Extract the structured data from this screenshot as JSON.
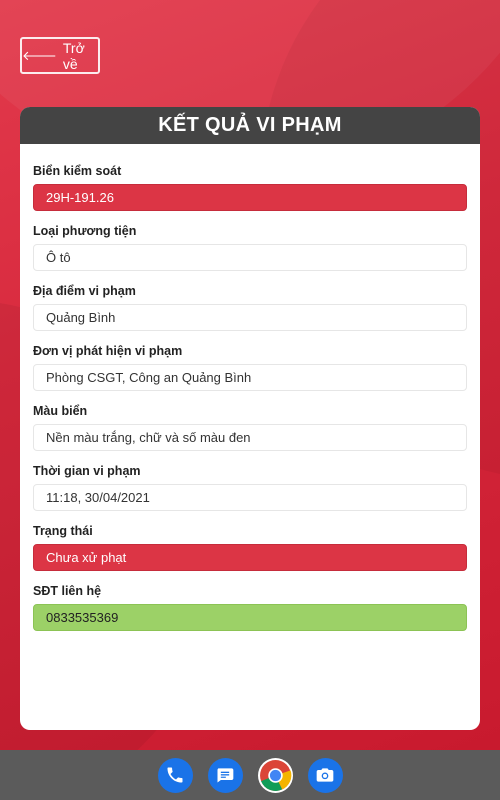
{
  "back_button": {
    "label": "Trở về",
    "icon": "arrow-left-icon"
  },
  "card": {
    "title": "KẾT QUẢ VI PHẠM",
    "fields": [
      {
        "label": "Biển kiểm soát",
        "value": "29H-191.26",
        "style": "red"
      },
      {
        "label": "Loại phương tiện",
        "value": "Ô tô",
        "style": "normal"
      },
      {
        "label": "Địa điểm vi phạm",
        "value": "Quảng Bình",
        "style": "normal"
      },
      {
        "label": "Đơn vị phát hiện vi phạm",
        "value": "Phòng CSGT, Công an Quảng Bình",
        "style": "normal"
      },
      {
        "label": "Màu biển",
        "value": "Nền màu trắng, chữ và số màu đen",
        "style": "normal"
      },
      {
        "label": "Thời gian vi phạm",
        "value": "11:18, 30/04/2021",
        "style": "normal"
      },
      {
        "label": "Trạng thái",
        "value": "Chưa xử phạt",
        "style": "red"
      },
      {
        "label": "SĐT liên hệ",
        "value": "0833535369",
        "style": "green"
      }
    ]
  },
  "dock": {
    "apps": [
      {
        "name": "phone-icon",
        "color": "#1a73e8"
      },
      {
        "name": "messages-icon",
        "color": "#1a73e8"
      },
      {
        "name": "chrome-icon",
        "color": "#ffffff"
      },
      {
        "name": "camera-icon",
        "color": "#1a73e8"
      }
    ]
  },
  "colors": {
    "background_red": "#d82a3e",
    "header_dark": "#444444",
    "status_red": "#dc3545",
    "contact_green": "#9cd167",
    "navbar_gray": "#5b5b5b"
  }
}
